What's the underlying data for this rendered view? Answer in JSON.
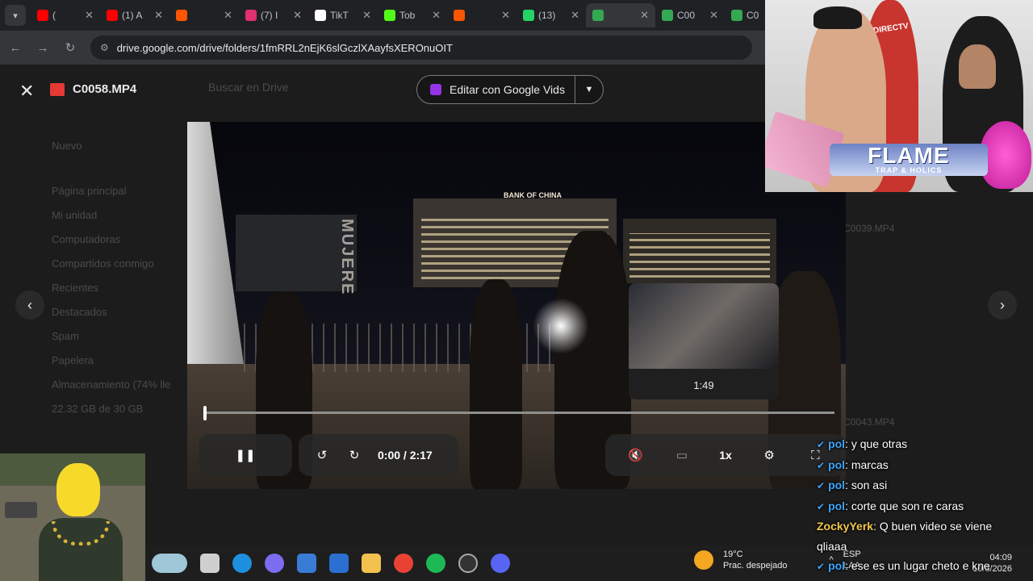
{
  "browser": {
    "tabs": [
      {
        "label": "(",
        "favicon": "youtube-icon",
        "color": "#ff0000"
      },
      {
        "label": "(1) A",
        "favicon": "youtube-icon",
        "color": "#ff0000"
      },
      {
        "label": "",
        "favicon": "soundcloud-icon",
        "color": "#ff5500"
      },
      {
        "label": "(7) I",
        "favicon": "instagram-icon",
        "color": "#e1306c"
      },
      {
        "label": "TikT",
        "favicon": "tiktok-icon",
        "color": "#ffffff"
      },
      {
        "label": "Tob",
        "favicon": "kick-icon",
        "color": "#53fc18"
      },
      {
        "label": "",
        "favicon": "soundcloud-icon",
        "color": "#ff5500"
      },
      {
        "label": "(13)",
        "favicon": "whatsapp-icon",
        "color": "#25d366"
      },
      {
        "label": "",
        "favicon": "drive-icon",
        "color": "#34a853"
      },
      {
        "label": "C00",
        "favicon": "drive-icon",
        "color": "#34a853"
      },
      {
        "label": "C0",
        "favicon": "drive-icon",
        "color": "#34a853"
      }
    ],
    "url": "drive.google.com/drive/folders/1fmRRL2nEjK6slGczlXAayfsXEROnuOIT"
  },
  "drive_bg": {
    "new_label": "Nuevo",
    "search_placeholder": "Buscar en Drive",
    "items": [
      "Página principal",
      "Mi unidad",
      "Computadoras",
      "Compartidos conmigo",
      "Recientes",
      "Destacados",
      "Spam",
      "Papelera",
      "Almacenamiento (74% lle",
      "22.32 GB de 30 GB"
    ],
    "file_labels": [
      "C0039.MP4",
      "C0043.MP4"
    ]
  },
  "viewer": {
    "file_name": "C0058.MP4",
    "edit_button": "Editar con Google Vids"
  },
  "video": {
    "sign_text": "BANK OF CHINA",
    "wall_text": "MUJERE",
    "preview_time": "1:49",
    "time_display": "0:00 / 2:17",
    "speed": "1x",
    "progress": 0.0
  },
  "webcam": {
    "banner": "FLAME",
    "banner_sub": "TRAP & HOLICS",
    "shirt_text": "DIRECTV"
  },
  "taskbar": {
    "temp": "19°C",
    "weather": "Prac. despejado",
    "lang": "ESP",
    "lang_sub": "LAA",
    "time": "04:09",
    "date": "10/3/2026"
  },
  "chat": [
    {
      "user": "pol",
      "msg": ": y que otras",
      "color": "blue"
    },
    {
      "user": "pol",
      "msg": ": marcas",
      "color": "blue"
    },
    {
      "user": "pol",
      "msg": ": son asi",
      "color": "blue"
    },
    {
      "user": "pol",
      "msg": ": corte que son re caras",
      "color": "blue"
    },
    {
      "user": "ZockyYerk",
      "msg": ": Q buen video se viene",
      "color": "yellow"
    },
    {
      "user": "",
      "msg": "qliaaa",
      "color": "none"
    },
    {
      "user": "pol",
      "msg": ": ese es un lugar cheto e kne",
      "color": "blue"
    }
  ]
}
